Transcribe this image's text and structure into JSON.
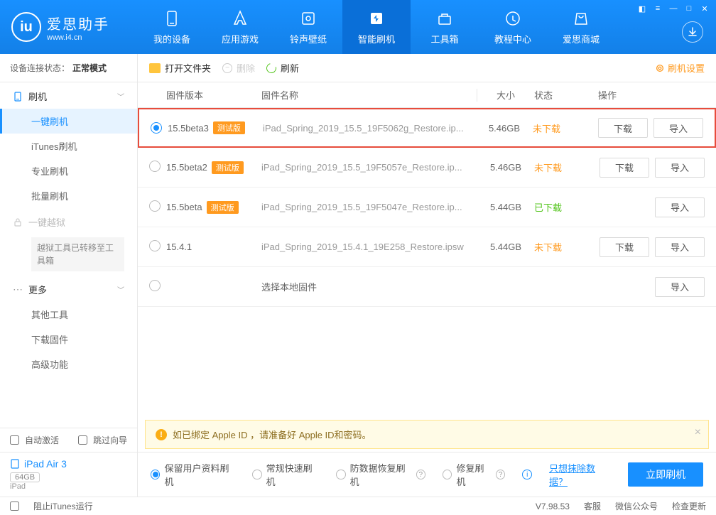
{
  "app": {
    "title": "爱思助手",
    "subtitle": "www.i4.cn"
  },
  "nav": {
    "items": [
      {
        "label": "我的设备"
      },
      {
        "label": "应用游戏"
      },
      {
        "label": "铃声壁纸"
      },
      {
        "label": "智能刷机"
      },
      {
        "label": "工具箱"
      },
      {
        "label": "教程中心"
      },
      {
        "label": "爱思商城"
      }
    ],
    "active_index": 3
  },
  "connection": {
    "label": "设备连接状态：",
    "value": "正常模式"
  },
  "sidebar": {
    "group_flash": {
      "label": "刷机"
    },
    "items_flash": [
      "一键刷机",
      "iTunes刷机",
      "专业刷机",
      "批量刷机"
    ],
    "group_jb": {
      "label": "一键越狱",
      "note": "越狱工具已转移至工具箱"
    },
    "group_more": {
      "label": "更多"
    },
    "items_more": [
      "其他工具",
      "下载固件",
      "高级功能"
    ]
  },
  "side_bottom": {
    "auto_activate": "自动激活",
    "skip_guide": "跳过向导",
    "device_name": "iPad Air 3",
    "capacity": "64GB",
    "device_type": "iPad"
  },
  "toolbar": {
    "open_folder": "打开文件夹",
    "delete": "删除",
    "refresh": "刷新",
    "settings": "刷机设置"
  },
  "table": {
    "headers": {
      "version": "固件版本",
      "name": "固件名称",
      "size": "大小",
      "status": "状态",
      "ops": "操作"
    },
    "rows": [
      {
        "version": "15.5beta3",
        "beta": "测试版",
        "name": "iPad_Spring_2019_15.5_19F5062g_Restore.ip...",
        "size": "5.46GB",
        "status": "未下载",
        "status_key": "no",
        "selected": true,
        "show_download": true
      },
      {
        "version": "15.5beta2",
        "beta": "测试版",
        "name": "iPad_Spring_2019_15.5_19F5057e_Restore.ip...",
        "size": "5.46GB",
        "status": "未下载",
        "status_key": "no",
        "selected": false,
        "show_download": true
      },
      {
        "version": "15.5beta",
        "beta": "测试版",
        "name": "iPad_Spring_2019_15.5_19F5047e_Restore.ip...",
        "size": "5.44GB",
        "status": "已下载",
        "status_key": "yes",
        "selected": false,
        "show_download": false
      },
      {
        "version": "15.4.1",
        "beta": "",
        "name": "iPad_Spring_2019_15.4.1_19E258_Restore.ipsw",
        "size": "5.44GB",
        "status": "未下载",
        "status_key": "no",
        "selected": false,
        "show_download": true
      },
      {
        "version": "",
        "beta": "",
        "name": "选择本地固件",
        "local": true
      }
    ],
    "btn_download": "下载",
    "btn_import": "导入"
  },
  "notice": {
    "text": "如已绑定 Apple ID ，请准备好 Apple ID和密码。"
  },
  "footer": {
    "opts": [
      "保留用户资料刷机",
      "常规快速刷机",
      "防数据恢复刷机",
      "修复刷机"
    ],
    "selected": 0,
    "erase_link": "只想抹除数据？",
    "flash_btn": "立即刷机"
  },
  "statusbar": {
    "block_itunes": "阻止iTunes运行",
    "version": "V7.98.53",
    "support": "客服",
    "wechat": "微信公众号",
    "update": "检查更新"
  }
}
